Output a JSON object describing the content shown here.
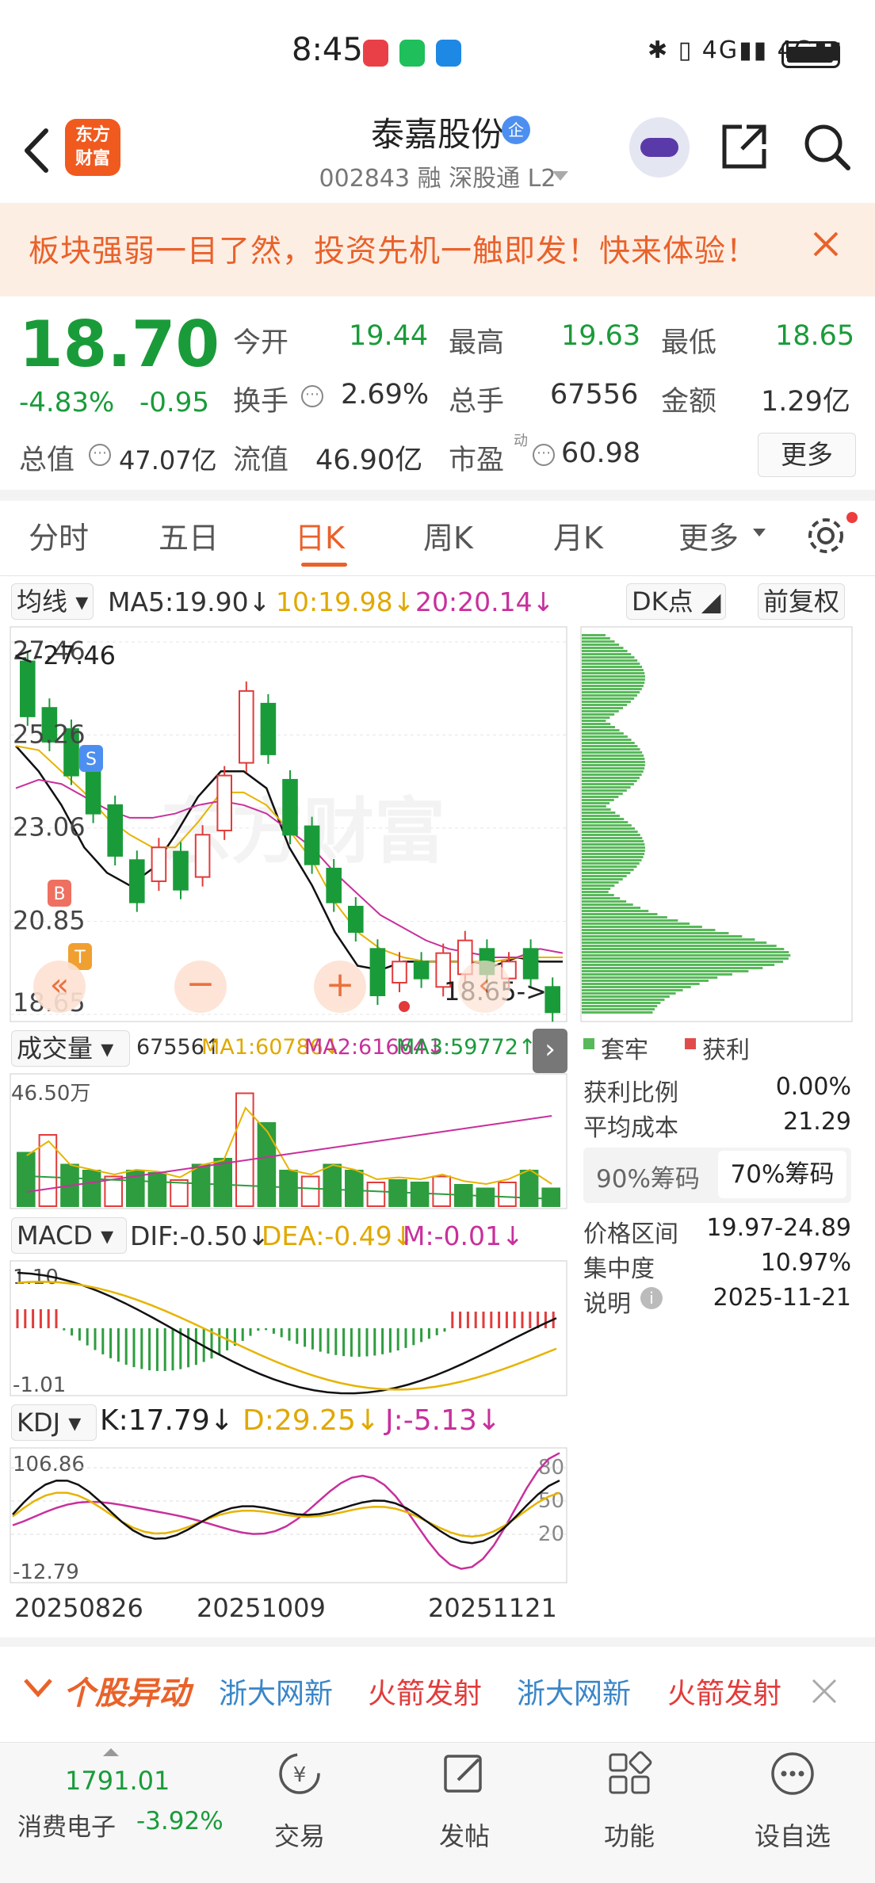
{
  "status": {
    "time": "8:45",
    "right": "✱ ▯ 4G▮▮ 4G▮▮"
  },
  "header": {
    "logo": "东方\n财富",
    "title": "泰嘉股份",
    "qi_badge": "企",
    "code_line": "002843 融 深股通 L2"
  },
  "banner": {
    "text": "板块强弱一目了然，投资先机一触即发！快来体验！"
  },
  "quote": {
    "price": "18.70",
    "pct": "-4.83%",
    "chg": "-0.95",
    "open_label": "今开",
    "open": "19.44",
    "high_label": "最高",
    "high": "19.63",
    "low_label": "最低",
    "low": "18.65",
    "turnover_label": "换手",
    "turnover": "2.69%",
    "volume_label": "总手",
    "volume": "67556",
    "amount_label": "金额",
    "amount": "1.29亿",
    "mcap_label": "总值",
    "mcap": "47.07亿",
    "float_label": "流值",
    "float": "46.90亿",
    "pe_label": "市盈",
    "pe_sup": "动",
    "pe": "60.98",
    "more": "更多"
  },
  "tabs": [
    "分时",
    "五日",
    "日K",
    "周K",
    "月K",
    "更多"
  ],
  "ma_bar": {
    "selector": "均线",
    "ma5": "MA5:19.90↓",
    "ma10": "10:19.98↓",
    "ma20": "20:20.14↓",
    "dk": "DK点",
    "fq": "前复权"
  },
  "kline": {
    "y_labels": [
      "27.46",
      "25.26",
      "23.06",
      "20.85",
      "18.65"
    ],
    "max_label": "<-27.46",
    "min_label": "18.65->",
    "watermark": "东方财富"
  },
  "volume": {
    "selector": "成交量",
    "vol": "67556↑",
    "ma1": "MA1:60786↓",
    "ma2": "MA2:61664↓",
    "ma3": "MA3:59772↑",
    "top": "46.50万"
  },
  "macd": {
    "selector": "MACD",
    "dif": "DIF:-0.50↓",
    "dea": "DEA:-0.49↓",
    "m": "M:-0.01↓",
    "top": "1.10",
    "bottom": "-1.01"
  },
  "kdj": {
    "selector": "KDJ",
    "k": "K:17.79↓",
    "d": "D:29.25↓",
    "j": "J:-5.13↓",
    "top": "106.86",
    "bottom": "-12.79",
    "r80": "80",
    "r50": "50",
    "r20": "20"
  },
  "dates": [
    "20250826",
    "20251009",
    "20251121"
  ],
  "chips": {
    "legend_trap": "套牢",
    "legend_profit": "获利",
    "profit_ratio_label": "获利比例",
    "profit_ratio": "0.00%",
    "avg_cost_label": "平均成本",
    "avg_cost": "21.29",
    "tab90": "90%筹码",
    "tab70": "70%筹码",
    "range_label": "价格区间",
    "range": "19.97-24.89",
    "conc_label": "集中度",
    "conc": "10.97%",
    "note_label": "说明",
    "note": "2025-11-21"
  },
  "ticker": {
    "title": "个股异动",
    "items": [
      "浙大网新",
      "火箭发射",
      "浙大网新",
      "火箭发射"
    ]
  },
  "bottom_nav": {
    "index_val": "1791.01",
    "index_name": "消费电子",
    "index_pct": "-3.92%",
    "trade": "交易",
    "post": "发帖",
    "func": "功能",
    "watch": "设自选"
  },
  "colors": {
    "up": "#e23b3b",
    "down": "#1a9b3a",
    "accent": "#e9622a",
    "ma5": "#111111",
    "ma10": "#e6b400",
    "ma20": "#c8309c"
  },
  "chart_data": [
    {
      "type": "candlestick",
      "title": "",
      "series": [
        {
          "name": "MA5",
          "values": [
            25.0,
            24.4,
            23.6,
            22.6,
            22.0,
            21.7,
            22.1,
            22.9,
            23.8,
            24.4,
            24.4,
            24.0,
            22.6,
            21.7,
            20.6,
            19.8,
            19.7,
            19.9,
            19.9,
            19.9,
            19.9,
            19.8,
            20.0,
            19.9,
            19.9
          ]
        },
        {
          "name": "MA10",
          "values": [
            25.0,
            24.9,
            24.4,
            23.9,
            23.3,
            22.9,
            22.6,
            22.6,
            23.2,
            23.9,
            23.9,
            23.6,
            23.0,
            22.3,
            21.3,
            20.6,
            20.2,
            20.0,
            19.9,
            19.9,
            19.9,
            19.9,
            20.0,
            20.0,
            20.0
          ]
        },
        {
          "name": "MA20",
          "values": [
            24.0,
            24.2,
            24.1,
            23.8,
            23.5,
            23.3,
            23.3,
            23.4,
            23.6,
            23.7,
            23.6,
            23.4,
            23.0,
            22.6,
            22.0,
            21.5,
            21.0,
            20.7,
            20.4,
            20.2,
            20.1,
            20.0,
            20.0,
            20.2,
            20.1
          ]
        }
      ],
      "ylim": [
        18.65,
        27.46
      ],
      "yticks": [
        "27.46",
        "25.26",
        "23.06",
        "20.85",
        "18.65"
      ]
    }
  ]
}
